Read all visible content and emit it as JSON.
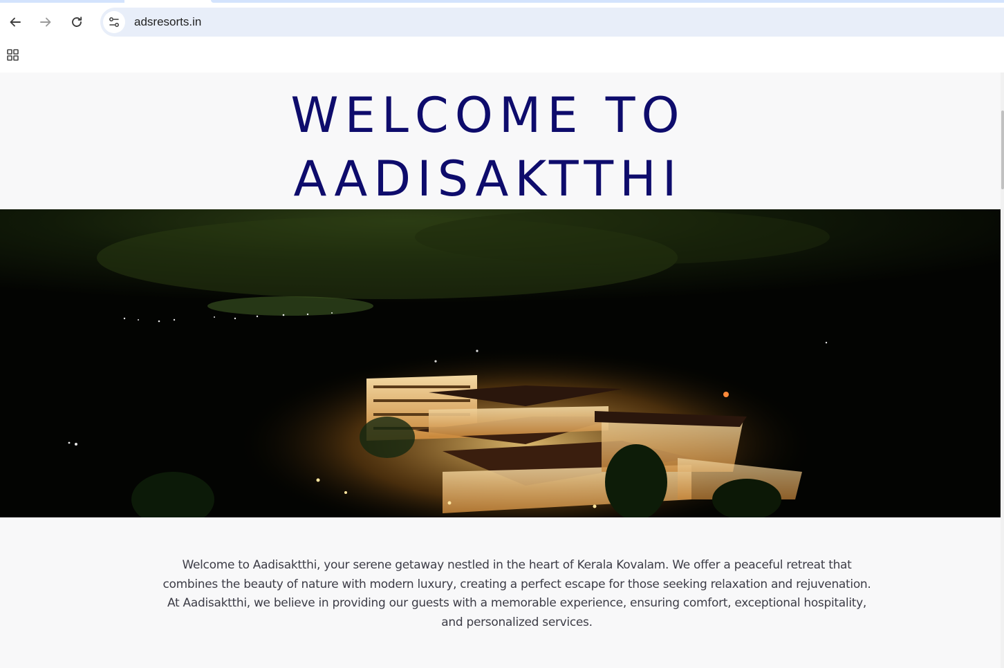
{
  "browser": {
    "url": "adsresorts.in",
    "back_icon": "arrow-left-icon",
    "forward_icon": "arrow-right-icon",
    "reload_icon": "reload-icon",
    "site_info_icon": "tune-icon",
    "apps_icon": "apps-grid-icon"
  },
  "page": {
    "title_line1": "WELCOME TO",
    "title_line2": "AADISAKTTHI",
    "hero_image_alt": "Aadisakthi resort at night, aerial view",
    "intro_text": "Welcome to Aadisaktthi, your serene getaway nestled in the heart of Kerala Kovalam. We offer a peaceful retreat that combines the beauty of nature with modern luxury, creating a perfect escape for those seeking relaxation and rejuvenation. At Aadisaktthi, we believe in providing our guests with a memorable experience, ensuring comfort, exceptional hospitality, and personalized services."
  },
  "colors": {
    "title": "#0e0c6c",
    "body_text": "#3c3c46",
    "page_bg": "#f8f8f9",
    "omnibox_bg": "#e8eef9"
  }
}
